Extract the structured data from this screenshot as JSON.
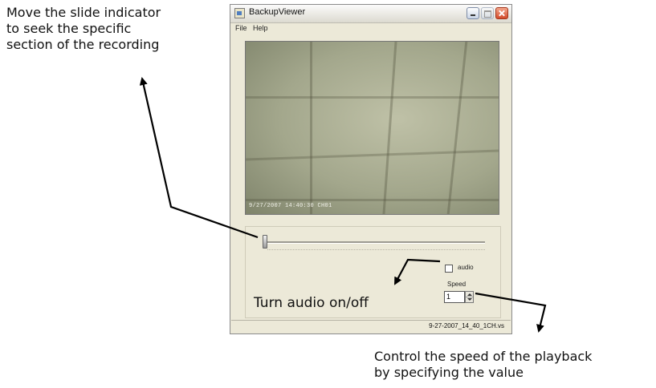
{
  "annotations": {
    "seek": "Move the slide indicator\nto seek the specific\nsection of the recording",
    "audio": "Turn audio on/off",
    "speed": "Control the speed of the playback\nby specifying the value"
  },
  "window": {
    "title": "BackupViewer",
    "menu": {
      "file": "File",
      "help": "Help"
    },
    "video_overlay": "9/27/2007 14:40:30 CH01",
    "seek_position": 0.0,
    "audio": {
      "label": "audio",
      "checked": false
    },
    "speed": {
      "label": "Speed",
      "value": "1"
    },
    "status_filename": "9-27-2007_14_40_1CH.vs"
  },
  "colors": {
    "window_bg": "#ece9d8",
    "close_button": "#d24a2a",
    "video_wall": "#a3a78c"
  }
}
